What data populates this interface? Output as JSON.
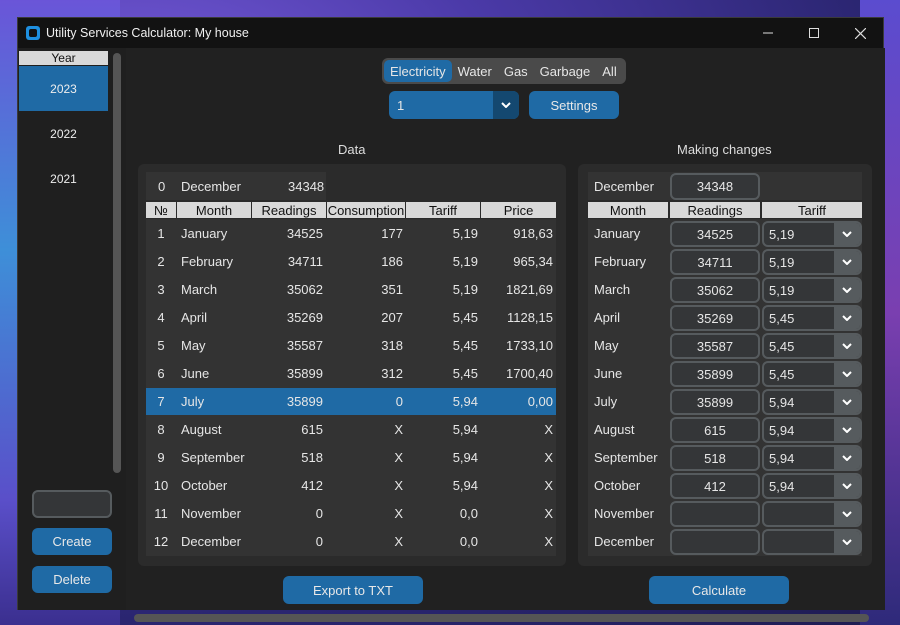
{
  "window": {
    "title": "Utility Services Calculator: My house"
  },
  "sidebar": {
    "header": "Year",
    "years": [
      "2023",
      "2022",
      "2021"
    ],
    "input_value": "",
    "create_label": "Create",
    "delete_label": "Delete"
  },
  "tabs": [
    "Electricity",
    "Water",
    "Gas",
    "Garbage",
    "All"
  ],
  "combo": {
    "value": "1"
  },
  "settings_label": "Settings",
  "data_section": {
    "title": "Data",
    "start_row": {
      "num": "0",
      "month": "December",
      "reading": "34348"
    },
    "columns": [
      "№",
      "Month",
      "Readings",
      "Consumption",
      "Tariff",
      "Price"
    ],
    "rows": [
      [
        "1",
        "January",
        "34525",
        "177",
        "5,19",
        "918,63"
      ],
      [
        "2",
        "February",
        "34711",
        "186",
        "5,19",
        "965,34"
      ],
      [
        "3",
        "March",
        "35062",
        "351",
        "5,19",
        "1821,69"
      ],
      [
        "4",
        "April",
        "35269",
        "207",
        "5,45",
        "1128,15"
      ],
      [
        "5",
        "May",
        "35587",
        "318",
        "5,45",
        "1733,10"
      ],
      [
        "6",
        "June",
        "35899",
        "312",
        "5,45",
        "1700,40"
      ],
      [
        "7",
        "July",
        "35899",
        "0",
        "5,94",
        "0,00"
      ],
      [
        "8",
        "August",
        "615",
        "X",
        "5,94",
        "X"
      ],
      [
        "9",
        "September",
        "518",
        "X",
        "5,94",
        "X"
      ],
      [
        "10",
        "October",
        "412",
        "X",
        "5,94",
        "X"
      ],
      [
        "11",
        "November",
        "0",
        "X",
        "0,0",
        "X"
      ],
      [
        "12",
        "December",
        "0",
        "X",
        "0,0",
        "X"
      ]
    ],
    "export_label": "Export to TXT"
  },
  "changes_section": {
    "title": "Making changes",
    "start_month": "December",
    "start_reading": "34348",
    "columns": [
      "Month",
      "Readings",
      "Tariff"
    ],
    "rows": [
      [
        "January",
        "34525",
        "5,19"
      ],
      [
        "February",
        "34711",
        "5,19"
      ],
      [
        "March",
        "35062",
        "5,19"
      ],
      [
        "April",
        "35269",
        "5,45"
      ],
      [
        "May",
        "35587",
        "5,45"
      ],
      [
        "June",
        "35899",
        "5,45"
      ],
      [
        "July",
        "35899",
        "5,94"
      ],
      [
        "August",
        "615",
        "5,94"
      ],
      [
        "September",
        "518",
        "5,94"
      ],
      [
        "October",
        "412",
        "5,94"
      ],
      [
        "November",
        "",
        ""
      ],
      [
        "December",
        "",
        ""
      ]
    ],
    "calculate_label": "Calculate"
  }
}
